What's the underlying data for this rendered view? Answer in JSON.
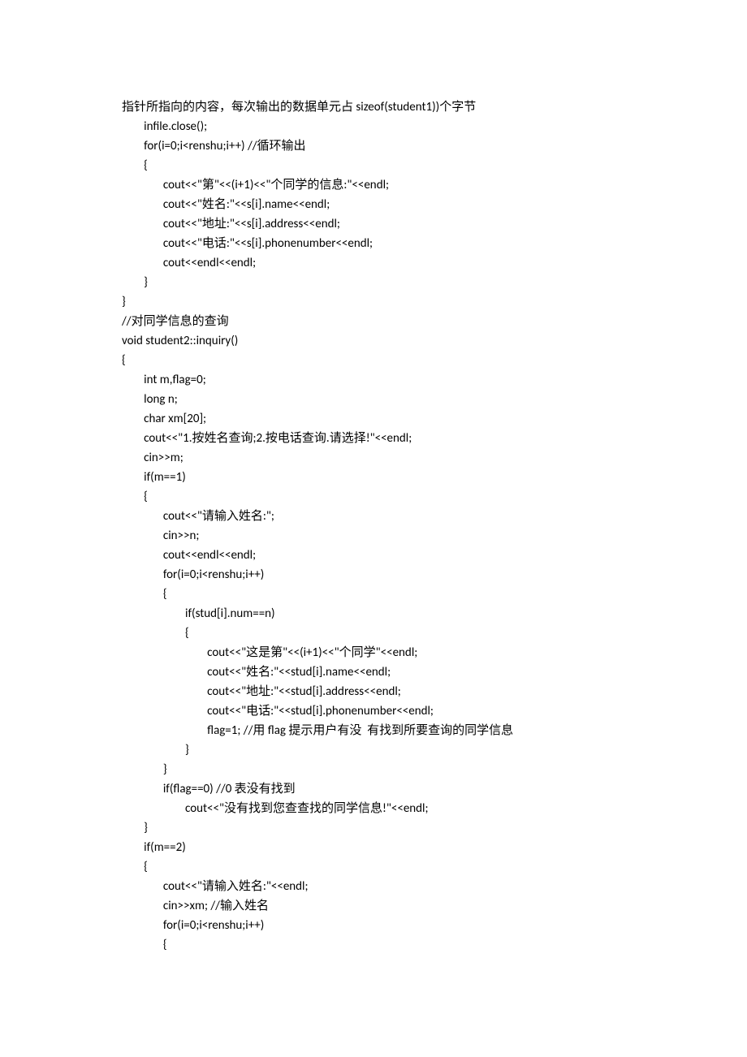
{
  "code": {
    "lines": [
      "指针所指向的内容，每次输出的数据单元占 sizeof(student1))个字节",
      "        infile.close();",
      "        for(i=0;i<renshu;i++) //循环输出",
      "        {",
      "               cout<<\"第\"<<(i+1)<<\"个同学的信息:\"<<endl;",
      "               cout<<\"姓名:\"<<s[i].name<<endl;",
      "               cout<<\"地址:\"<<s[i].address<<endl;",
      "               cout<<\"电话:\"<<s[i].phonenumber<<endl;",
      "               cout<<endl<<endl;",
      "        }",
      "}",
      "//对同学信息的查询",
      "void student2::inquiry()",
      "{",
      "        int m,flag=0;",
      "        long n;",
      "        char xm[20];",
      "        cout<<\"1.按姓名查询;2.按电话查询.请选择!\"<<endl;",
      "        cin>>m;",
      "        if(m==1)",
      "        {",
      "               cout<<\"请输入姓名:\";",
      "               cin>>n;",
      "               cout<<endl<<endl;",
      "               for(i=0;i<renshu;i++)",
      "               {",
      "                       if(stud[i].num==n)",
      "                       {",
      "                               cout<<\"这是第\"<<(i+1)<<\"个同学\"<<endl;",
      "                               cout<<\"姓名:\"<<stud[i].name<<endl;",
      "                               cout<<\"地址:\"<<stud[i].address<<endl;",
      "                               cout<<\"电话:\"<<stud[i].phonenumber<<endl;",
      "                               flag=1; //用 flag 提示用户有没  有找到所要查询的同学信息",
      "                       }",
      "               }",
      "               if(flag==0) //0 表没有找到",
      "                       cout<<\"没有找到您查查找的同学信息!\"<<endl;",
      "        }",
      "        if(m==2)",
      "        {",
      "               cout<<\"请输入姓名:\"<<endl;",
      "               cin>>xm; //输入姓名",
      "               for(i=0;i<renshu;i++)",
      "               {"
    ]
  }
}
